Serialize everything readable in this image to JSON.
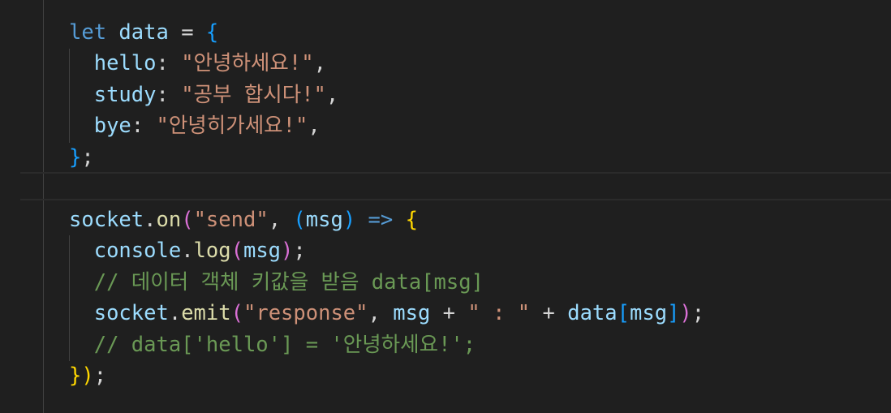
{
  "code": {
    "l1": {
      "kw": "let",
      "var": "data",
      "eq": "=",
      "brace": "{"
    },
    "l2": {
      "key": "hello",
      "colon": ":",
      "str": "\"안녕하세요!\"",
      "comma": ","
    },
    "l3": {
      "key": "study",
      "colon": ":",
      "str": "\"공부 합시다!\"",
      "comma": ","
    },
    "l4": {
      "key": "bye",
      "colon": ":",
      "str": "\"안녕히가세요!\"",
      "comma": ","
    },
    "l5": {
      "brace": "}",
      "semi": ";"
    },
    "l7": {
      "obj": "socket",
      "dot": ".",
      "fn": "on",
      "paren": "(",
      "str": "\"send\"",
      "comma": ",",
      "paren2": "(",
      "param": "msg",
      "paren2c": ")",
      "arrow": "=>",
      "brace": "{"
    },
    "l8": {
      "obj": "console",
      "dot": ".",
      "fn": "log",
      "paren": "(",
      "arg": "msg",
      "parenc": ")",
      "semi": ";"
    },
    "l9": {
      "comment": "// 데이터 객체 키값을 받음 data[msg]"
    },
    "l10": {
      "obj": "socket",
      "dot": ".",
      "fn": "emit",
      "paren": "(",
      "str1": "\"response\"",
      "comma": ",",
      "msg": "msg",
      "plus1": "+",
      "str2": "\" : \"",
      "plus2": "+",
      "data": "data",
      "bopen": "[",
      "key": "msg",
      "bclose": "]",
      "parenc": ")",
      "semi": ";"
    },
    "l11": {
      "comment": "// data['hello'] = '안녕하세요!';"
    },
    "l12": {
      "brace": "}",
      "paren": ")",
      "semi": ";"
    }
  }
}
